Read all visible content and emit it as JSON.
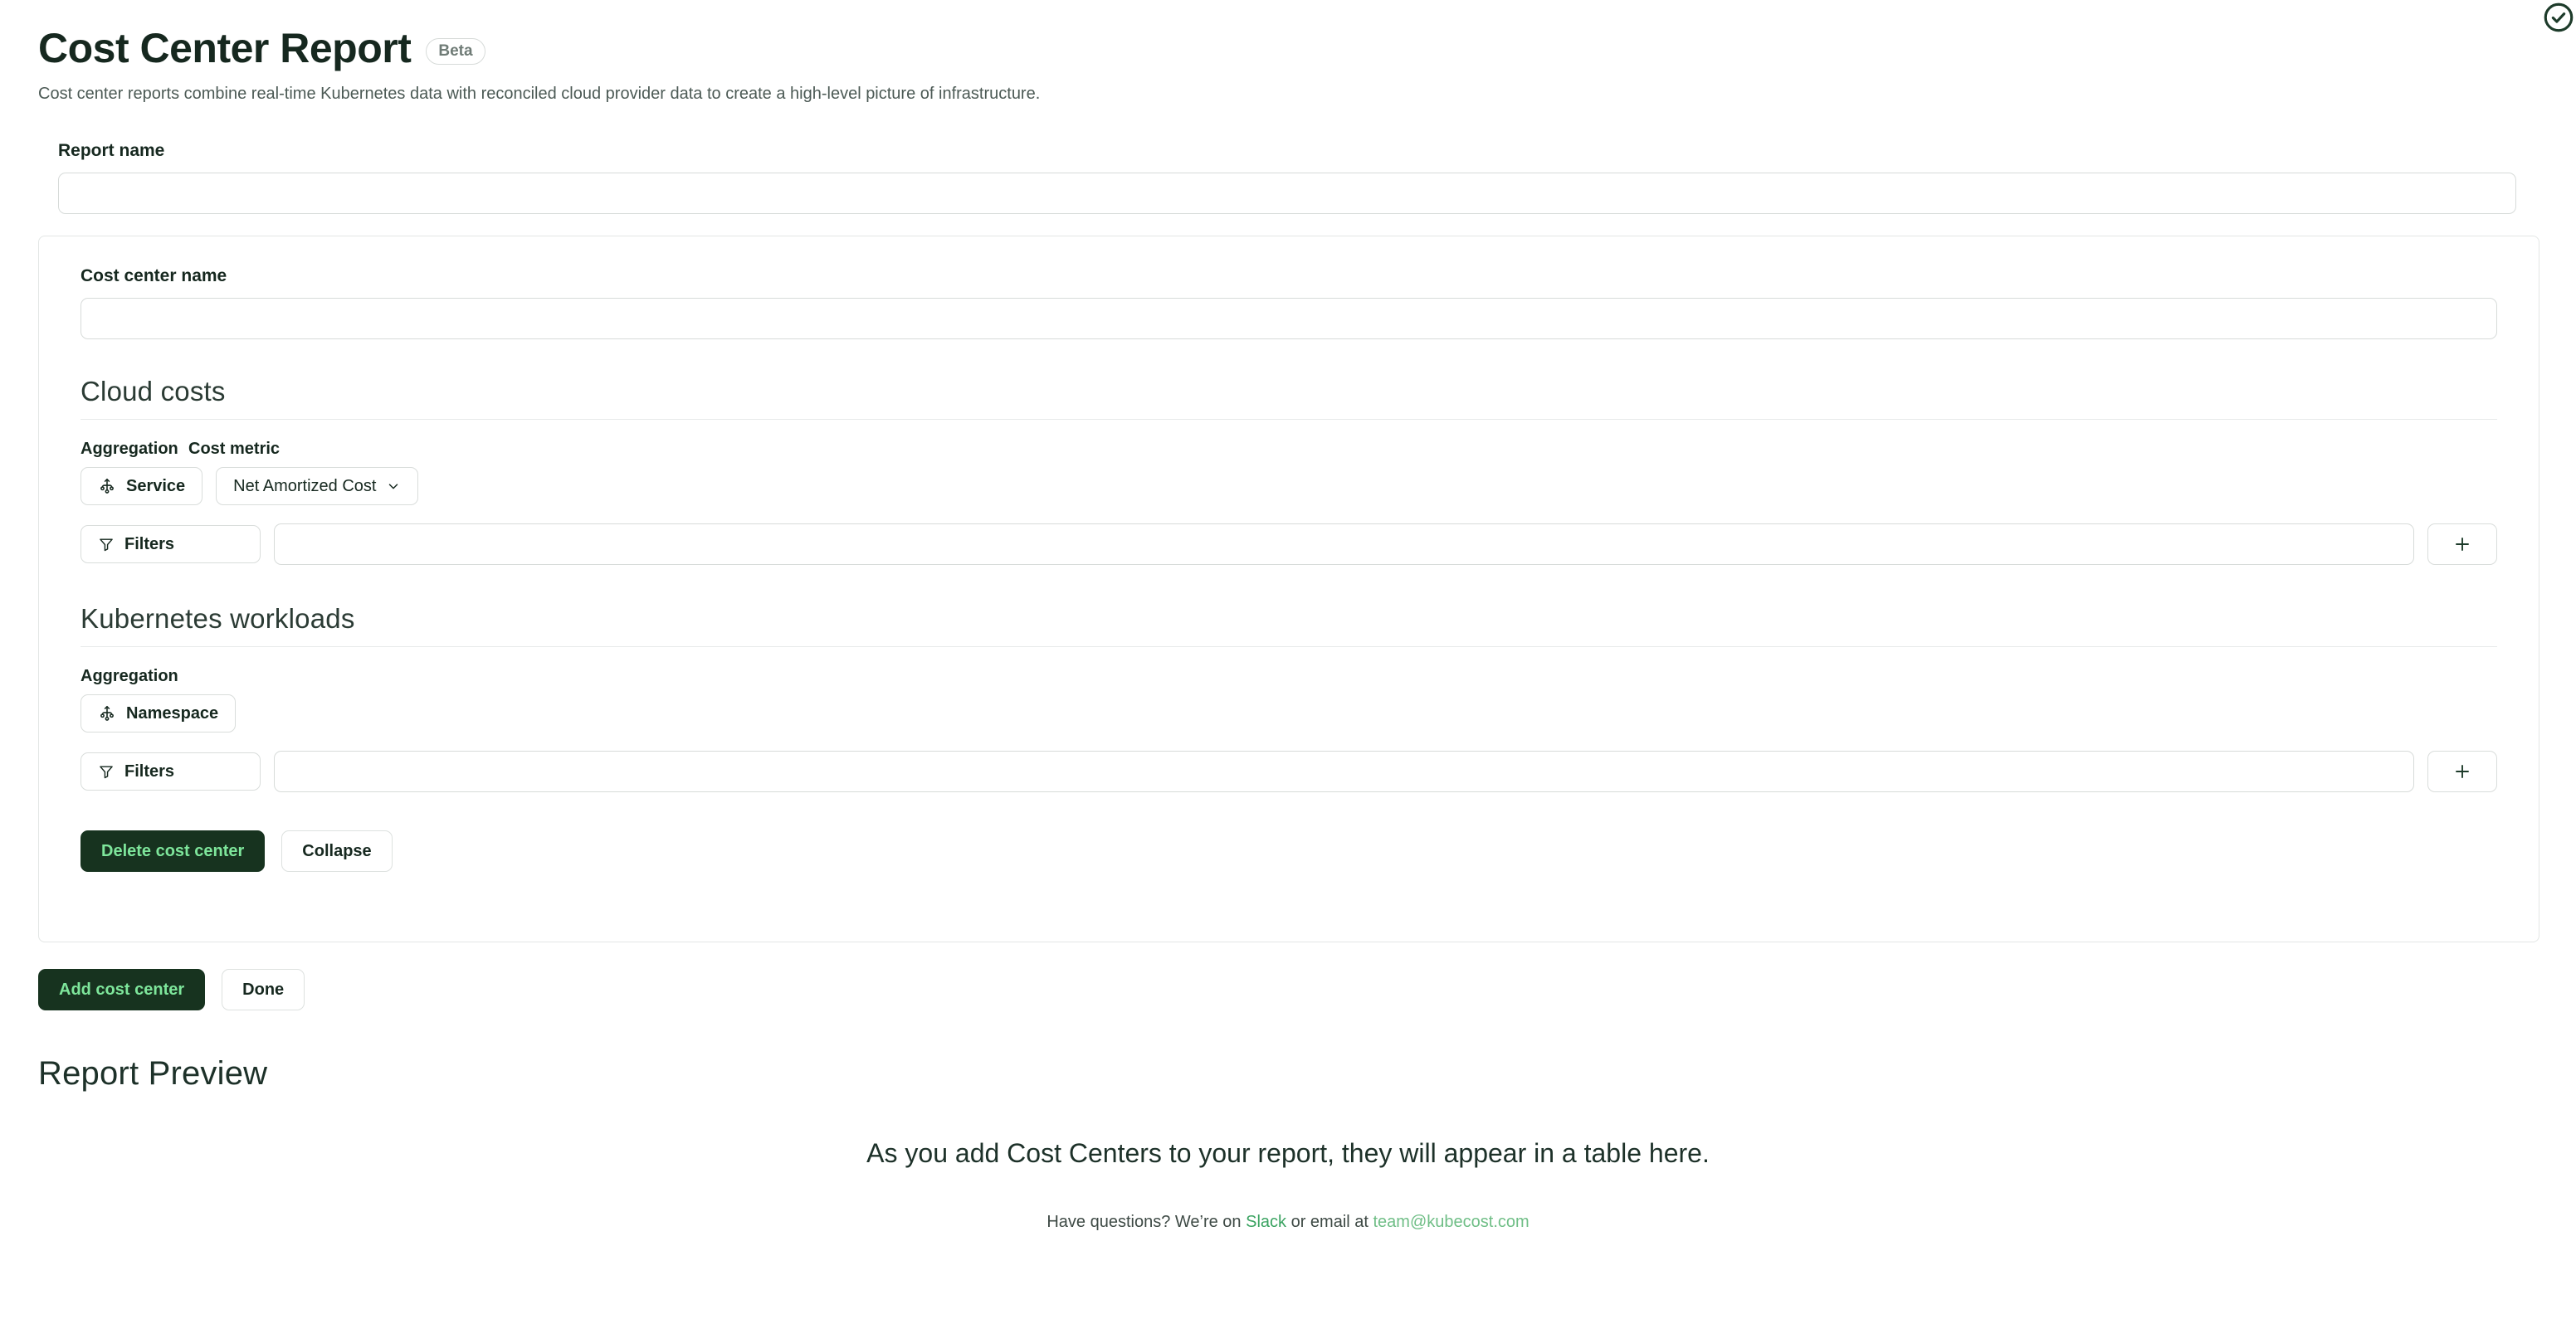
{
  "header": {
    "title": "Cost Center Report",
    "badge": "Beta",
    "description": "Cost center reports combine real-time Kubernetes data with reconciled cloud provider data to create a high-level picture of infrastructure.",
    "status_icon": "check-circle-icon"
  },
  "report_name": {
    "label": "Report name",
    "value": "",
    "placeholder": ""
  },
  "cost_center": {
    "name": {
      "label": "Cost center name",
      "value": "",
      "placeholder": ""
    },
    "cloud_costs": {
      "heading": "Cloud costs",
      "aggregation_label": "Aggregation",
      "aggregation_value": "Service",
      "aggregation_icon": "hierarchy-icon",
      "cost_metric_label": "Cost metric",
      "cost_metric_value": "Net Amortized Cost",
      "cost_metric_chevron": "chevron-down-icon",
      "filters_label": "Filters",
      "filters_icon": "funnel-icon",
      "filters_value": "",
      "filters_placeholder": "",
      "add_filter_icon": "plus-icon"
    },
    "kubernetes_workloads": {
      "heading": "Kubernetes workloads",
      "aggregation_label": "Aggregation",
      "aggregation_value": "Namespace",
      "aggregation_icon": "hierarchy-icon",
      "filters_label": "Filters",
      "filters_icon": "funnel-icon",
      "filters_value": "",
      "filters_placeholder": "",
      "add_filter_icon": "plus-icon"
    },
    "delete_label": "Delete cost center",
    "collapse_label": "Collapse"
  },
  "bottom_actions": {
    "add_label": "Add cost center",
    "done_label": "Done"
  },
  "preview": {
    "title": "Report Preview",
    "empty_message": "As you add Cost Centers to your report, they will appear in a table here.",
    "footer_prefix": "Have questions? We’re on ",
    "footer_link_slack": "Slack",
    "footer_middle": " or email at ",
    "footer_email": "team@kubecost.com"
  },
  "colors": {
    "primary_dark": "#17331f",
    "primary_text": "#7ee69b",
    "link_green": "#3aa361",
    "heading": "#16281f",
    "border": "#d9dddb"
  }
}
